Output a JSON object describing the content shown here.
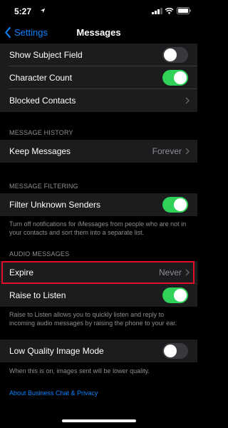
{
  "status_bar": {
    "time": "5:27"
  },
  "nav": {
    "back_label": "Settings",
    "title": "Messages"
  },
  "rows": {
    "show_subject_field": {
      "label": "Show Subject Field",
      "on": false
    },
    "character_count": {
      "label": "Character Count",
      "on": true
    },
    "blocked_contacts": {
      "label": "Blocked Contacts"
    },
    "keep_messages": {
      "label": "Keep Messages",
      "value": "Forever"
    },
    "filter_unknown_senders": {
      "label": "Filter Unknown Senders",
      "on": true
    },
    "expire": {
      "label": "Expire",
      "value": "Never"
    },
    "raise_to_listen": {
      "label": "Raise to Listen",
      "on": true
    },
    "low_quality_image_mode": {
      "label": "Low Quality Image Mode",
      "on": false
    }
  },
  "sections": {
    "message_history": "MESSAGE HISTORY",
    "message_filtering": "MESSAGE FILTERING",
    "audio_messages": "AUDIO MESSAGES"
  },
  "footnotes": {
    "filter": "Turn off notifications for iMessages from people who are not in your contacts and sort them into a separate list.",
    "raise": "Raise to Listen allows you to quickly listen and reply to incoming audio messages by raising the phone to your ear.",
    "low_quality": "When this is on, images sent will be lower quality."
  },
  "link": "About Business Chat & Privacy",
  "colors": {
    "accent": "#0a84ff",
    "toggle_on": "#30d158",
    "highlight": "#e0102a"
  }
}
